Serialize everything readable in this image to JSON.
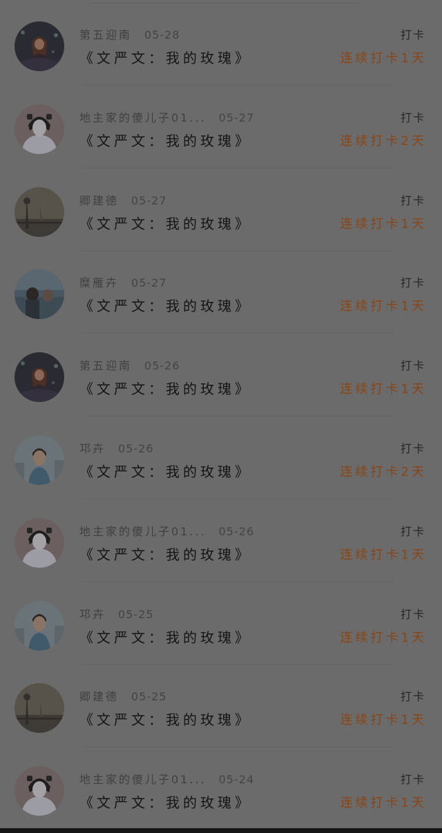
{
  "records": [
    {
      "user": "第五迎南",
      "date": "05-28",
      "action": "打卡",
      "title": "《文严文：我的玫瑰》",
      "streak": "连续打卡1天",
      "avatar": "avatar-woman-stage"
    },
    {
      "user": "地主家的傻儿子01...",
      "date": "05-27",
      "action": "打卡",
      "title": "《文严文：我的玫瑰》",
      "streak": "连续打卡2天",
      "avatar": "avatar-girl-white"
    },
    {
      "user": "卿建德",
      "date": "05-27",
      "action": "打卡",
      "title": "《文严文：我的玫瑰》",
      "streak": "连续打卡1天",
      "avatar": "avatar-eiffel-tower"
    },
    {
      "user": "糜雁卉",
      "date": "05-27",
      "action": "打卡",
      "title": "《文严文：我的玫瑰》",
      "streak": "连续打卡1天",
      "avatar": "avatar-couple-water"
    },
    {
      "user": "第五迎南",
      "date": "05-26",
      "action": "打卡",
      "title": "《文严文：我的玫瑰》",
      "streak": "连续打卡1天",
      "avatar": "avatar-woman-stage"
    },
    {
      "user": "邛卉",
      "date": "05-26",
      "action": "打卡",
      "title": "《文严文：我的玫瑰》",
      "streak": "连续打卡2天",
      "avatar": "avatar-boy-city"
    },
    {
      "user": "地主家的傻儿子01...",
      "date": "05-26",
      "action": "打卡",
      "title": "《文严文：我的玫瑰》",
      "streak": "连续打卡1天",
      "avatar": "avatar-girl-white"
    },
    {
      "user": "邛卉",
      "date": "05-25",
      "action": "打卡",
      "title": "《文严文：我的玫瑰》",
      "streak": "连续打卡1天",
      "avatar": "avatar-boy-city"
    },
    {
      "user": "卿建德",
      "date": "05-25",
      "action": "打卡",
      "title": "《文严文：我的玫瑰》",
      "streak": "连续打卡1天",
      "avatar": "avatar-eiffel-tower"
    },
    {
      "user": "地主家的傻儿子01...",
      "date": "05-24",
      "action": "打卡",
      "title": "《文严文：我的玫瑰》",
      "streak": "连续打卡1天",
      "avatar": "avatar-girl-white"
    }
  ],
  "colors": {
    "overlay": "#6b6b6b",
    "streak": "#8a4516",
    "username": "#3f3f3f",
    "title": "#151515"
  }
}
